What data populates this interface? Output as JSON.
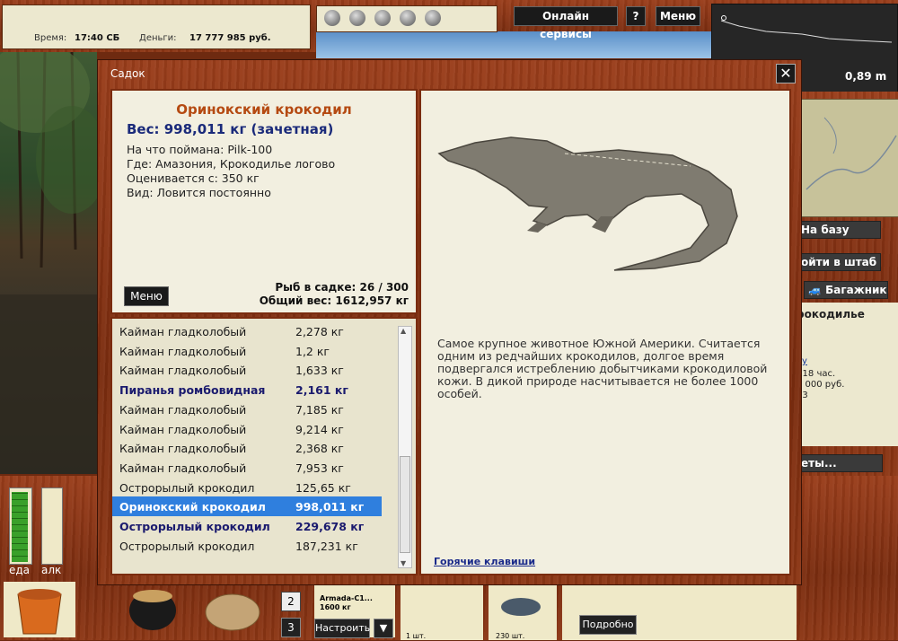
{
  "topbar": {
    "time_label": "Время:",
    "time_value": "17:40 СБ",
    "money_label": "Деньги:",
    "money_value": "17 777 985 руб.",
    "online_services": "Онлайн сервисы",
    "help": "?",
    "menu": "Меню",
    "depth": "0,89 m"
  },
  "right": {
    "to_base": "На базу",
    "go_hq": "ойти в штаб",
    "trunk": "Багажник",
    "info_title": "рокодилье",
    "info_link": "ку",
    "info_l1": ": 18 час.",
    "info_l2": "0 000 руб.",
    "info_l3": "13",
    "bottom_btn": "еты..."
  },
  "bottom": {
    "food": "еда",
    "alc": "алк",
    "slot2": "2",
    "slot3": "3",
    "rod_name": "Armada-C1...",
    "rod_weight": "1600 кг",
    "setup": "Настроить",
    "count1": "1 шт.",
    "count2": "230 шт.",
    "details": "Подробно"
  },
  "dialog": {
    "title": "Садок",
    "close": "✕",
    "fish_name": "Оринокский крокодил",
    "weight_line": "Вес: 998,011 кг (зачетная)",
    "caught_on": "На что поймана: Pilk-100",
    "where": "Где: Амазония, Крокодилье логово",
    "price": "Оценивается с: 350 кг",
    "kind": "Вид: Ловится постоянно",
    "menu_btn": "Меню",
    "fish_count": "Рыб в садке: 26 / 300",
    "total_weight": "Общий вес: 1612,957 кг",
    "description": "Самое крупное животное Южной Америки. Считается одним из редчайших крокодилов, долгое время подвергался истреблению добытчиками крокодиловой кожи.  В дикой природе насчитывается не более 1000 особей.",
    "hotkeys": "Горячие клавиши"
  },
  "fish_list": [
    {
      "name": "Кайман гладколобый",
      "weight": "2,278 кг",
      "style": "normal"
    },
    {
      "name": "Кайман гладколобый",
      "weight": "1,2 кг",
      "style": "normal"
    },
    {
      "name": "Кайман гладколобый",
      "weight": "1,633 кг",
      "style": "normal"
    },
    {
      "name": "Пиранья ромбовидная",
      "weight": "2,161 кг",
      "style": "bold"
    },
    {
      "name": "Кайман гладколобый",
      "weight": "7,185 кг",
      "style": "normal"
    },
    {
      "name": "Кайман гладколобый",
      "weight": "9,214 кг",
      "style": "normal"
    },
    {
      "name": "Кайман гладколобый",
      "weight": "2,368 кг",
      "style": "normal"
    },
    {
      "name": "Кайман гладколобый",
      "weight": "7,953 кг",
      "style": "normal"
    },
    {
      "name": "Острорылый крокодил",
      "weight": "125,65 кг",
      "style": "normal"
    },
    {
      "name": "Оринокский крокодил",
      "weight": "998,011 кг",
      "style": "selected"
    },
    {
      "name": "Острорылый крокодил",
      "weight": "229,678 кг",
      "style": "bold"
    },
    {
      "name": "Острорылый крокодил",
      "weight": "187,231 кг",
      "style": "normal"
    }
  ]
}
